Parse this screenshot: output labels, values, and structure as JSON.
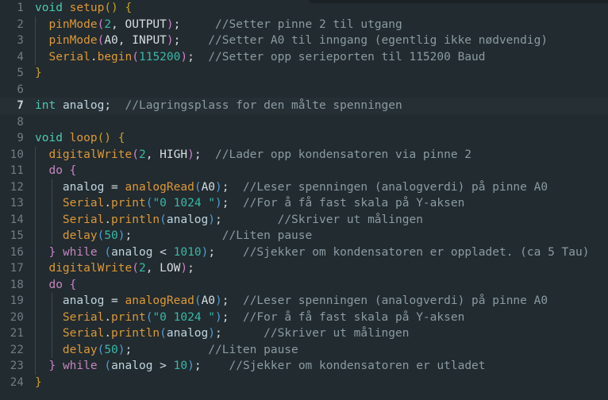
{
  "editor": {
    "language": "Arduino / C++",
    "theme": "dark",
    "active_line": 7,
    "total_lines": 24,
    "colors": {
      "background": "#222b2f",
      "active_line_background": "#262f34",
      "gutter_text": "#707f85",
      "default_text": "#d4dce0",
      "comment": "#8a9ba2",
      "type_keyword": "#4ec9b0",
      "function": "#dc9838",
      "control_keyword": "#c586c0",
      "number": "#39b8a8",
      "string": "#39b8a8",
      "variable": "#bfd4de",
      "bracket_level_1": "#c9a227",
      "bracket_level_2": "#cf7fcf",
      "bracket_level_3": "#4f9cd8",
      "indent_guide": "#3d4a50"
    },
    "line_numbers": [
      1,
      2,
      3,
      4,
      5,
      6,
      7,
      8,
      9,
      10,
      11,
      12,
      13,
      14,
      15,
      16,
      17,
      18,
      19,
      20,
      21,
      22,
      23,
      24
    ],
    "lines": [
      {
        "n": 1,
        "indent_guides": 0,
        "tokens": [
          {
            "c": "t-type",
            "t": "void"
          },
          {
            "c": "t-plain",
            "t": " "
          },
          {
            "c": "t-func",
            "t": "setup"
          },
          {
            "c": "t-paren1",
            "t": "()"
          },
          {
            "c": "t-plain",
            "t": " "
          },
          {
            "c": "t-brace",
            "t": "{"
          }
        ]
      },
      {
        "n": 2,
        "indent_guides": 1,
        "tokens": [
          {
            "c": "t-plain",
            "t": "  "
          },
          {
            "c": "t-func",
            "t": "pinMode"
          },
          {
            "c": "t-paren2",
            "t": "("
          },
          {
            "c": "t-num",
            "t": "2"
          },
          {
            "c": "t-punc",
            "t": ", "
          },
          {
            "c": "t-const",
            "t": "OUTPUT"
          },
          {
            "c": "t-paren2",
            "t": ")"
          },
          {
            "c": "t-punc",
            "t": ";"
          },
          {
            "c": "t-plain",
            "t": "     "
          },
          {
            "c": "t-comment",
            "t": "//Setter pinne 2 til utgang"
          }
        ]
      },
      {
        "n": 3,
        "indent_guides": 1,
        "tokens": [
          {
            "c": "t-plain",
            "t": "  "
          },
          {
            "c": "t-func",
            "t": "pinMode"
          },
          {
            "c": "t-paren2",
            "t": "("
          },
          {
            "c": "t-const",
            "t": "A0"
          },
          {
            "c": "t-punc",
            "t": ", "
          },
          {
            "c": "t-const",
            "t": "INPUT"
          },
          {
            "c": "t-paren2",
            "t": ")"
          },
          {
            "c": "t-punc",
            "t": ";"
          },
          {
            "c": "t-plain",
            "t": "    "
          },
          {
            "c": "t-comment",
            "t": "//Setter A0 til inngang (egentlig ikke nødvendig)"
          }
        ]
      },
      {
        "n": 4,
        "indent_guides": 1,
        "tokens": [
          {
            "c": "t-plain",
            "t": "  "
          },
          {
            "c": "t-func",
            "t": "Serial"
          },
          {
            "c": "t-punc",
            "t": "."
          },
          {
            "c": "t-func",
            "t": "begin"
          },
          {
            "c": "t-paren2",
            "t": "("
          },
          {
            "c": "t-num",
            "t": "115200"
          },
          {
            "c": "t-paren2",
            "t": ")"
          },
          {
            "c": "t-punc",
            "t": ";"
          },
          {
            "c": "t-plain",
            "t": "  "
          },
          {
            "c": "t-comment",
            "t": "//Setter opp serieporten til 115200 Baud"
          }
        ]
      },
      {
        "n": 5,
        "indent_guides": 0,
        "tokens": [
          {
            "c": "t-brace",
            "t": "}"
          }
        ]
      },
      {
        "n": 6,
        "indent_guides": 0,
        "tokens": []
      },
      {
        "n": 7,
        "indent_guides": 0,
        "tokens": [
          {
            "c": "t-type",
            "t": "int"
          },
          {
            "c": "t-plain",
            "t": " "
          },
          {
            "c": "t-var",
            "t": "analog"
          },
          {
            "c": "t-punc",
            "t": ";"
          },
          {
            "c": "t-plain",
            "t": "  "
          },
          {
            "c": "t-comment",
            "t": "//Lagringsplass for den målte spenningen"
          }
        ]
      },
      {
        "n": 8,
        "indent_guides": 0,
        "tokens": []
      },
      {
        "n": 9,
        "indent_guides": 0,
        "tokens": [
          {
            "c": "t-type",
            "t": "void"
          },
          {
            "c": "t-plain",
            "t": " "
          },
          {
            "c": "t-func",
            "t": "loop"
          },
          {
            "c": "t-paren1",
            "t": "()"
          },
          {
            "c": "t-plain",
            "t": " "
          },
          {
            "c": "t-brace",
            "t": "{"
          }
        ]
      },
      {
        "n": 10,
        "indent_guides": 1,
        "tokens": [
          {
            "c": "t-plain",
            "t": "  "
          },
          {
            "c": "t-func",
            "t": "digitalWrite"
          },
          {
            "c": "t-paren2",
            "t": "("
          },
          {
            "c": "t-num",
            "t": "2"
          },
          {
            "c": "t-punc",
            "t": ", "
          },
          {
            "c": "t-const",
            "t": "HIGH"
          },
          {
            "c": "t-paren2",
            "t": ")"
          },
          {
            "c": "t-punc",
            "t": ";"
          },
          {
            "c": "t-plain",
            "t": "  "
          },
          {
            "c": "t-comment",
            "t": "//Lader opp kondensatoren via pinne 2"
          }
        ]
      },
      {
        "n": 11,
        "indent_guides": 1,
        "tokens": [
          {
            "c": "t-plain",
            "t": "  "
          },
          {
            "c": "t-kw",
            "t": "do"
          },
          {
            "c": "t-plain",
            "t": " "
          },
          {
            "c": "t-paren2",
            "t": "{"
          }
        ]
      },
      {
        "n": 12,
        "indent_guides": 2,
        "tokens": [
          {
            "c": "t-plain",
            "t": "    "
          },
          {
            "c": "t-var",
            "t": "analog"
          },
          {
            "c": "t-op",
            "t": " = "
          },
          {
            "c": "t-func",
            "t": "analogRead"
          },
          {
            "c": "t-paren3",
            "t": "("
          },
          {
            "c": "t-const",
            "t": "A0"
          },
          {
            "c": "t-paren3",
            "t": ")"
          },
          {
            "c": "t-punc",
            "t": ";"
          },
          {
            "c": "t-plain",
            "t": "  "
          },
          {
            "c": "t-comment",
            "t": "//Leser spenningen (analogverdi) på pinne A0"
          }
        ]
      },
      {
        "n": 13,
        "indent_guides": 2,
        "tokens": [
          {
            "c": "t-plain",
            "t": "    "
          },
          {
            "c": "t-func",
            "t": "Serial"
          },
          {
            "c": "t-punc",
            "t": "."
          },
          {
            "c": "t-func",
            "t": "print"
          },
          {
            "c": "t-paren3",
            "t": "("
          },
          {
            "c": "t-str",
            "t": "\"0 1024 \""
          },
          {
            "c": "t-paren3",
            "t": ")"
          },
          {
            "c": "t-punc",
            "t": ";"
          },
          {
            "c": "t-plain",
            "t": "  "
          },
          {
            "c": "t-comment",
            "t": "//For å få fast skala på Y-aksen"
          }
        ]
      },
      {
        "n": 14,
        "indent_guides": 2,
        "tokens": [
          {
            "c": "t-plain",
            "t": "    "
          },
          {
            "c": "t-func",
            "t": "Serial"
          },
          {
            "c": "t-punc",
            "t": "."
          },
          {
            "c": "t-func",
            "t": "println"
          },
          {
            "c": "t-paren3",
            "t": "("
          },
          {
            "c": "t-var",
            "t": "analog"
          },
          {
            "c": "t-paren3",
            "t": ")"
          },
          {
            "c": "t-punc",
            "t": ";"
          },
          {
            "c": "t-plain",
            "t": "        "
          },
          {
            "c": "t-comment",
            "t": "//Skriver ut målingen"
          }
        ]
      },
      {
        "n": 15,
        "indent_guides": 2,
        "tokens": [
          {
            "c": "t-plain",
            "t": "    "
          },
          {
            "c": "t-func",
            "t": "delay"
          },
          {
            "c": "t-paren3",
            "t": "("
          },
          {
            "c": "t-num",
            "t": "50"
          },
          {
            "c": "t-paren3",
            "t": ")"
          },
          {
            "c": "t-punc",
            "t": ";"
          },
          {
            "c": "t-plain",
            "t": "             "
          },
          {
            "c": "t-comment",
            "t": "//Liten pause"
          }
        ]
      },
      {
        "n": 16,
        "indent_guides": 1,
        "tokens": [
          {
            "c": "t-plain",
            "t": "  "
          },
          {
            "c": "t-paren2",
            "t": "}"
          },
          {
            "c": "t-plain",
            "t": " "
          },
          {
            "c": "t-kw",
            "t": "while"
          },
          {
            "c": "t-plain",
            "t": " "
          },
          {
            "c": "t-paren3",
            "t": "("
          },
          {
            "c": "t-var",
            "t": "analog"
          },
          {
            "c": "t-op",
            "t": " < "
          },
          {
            "c": "t-num",
            "t": "1010"
          },
          {
            "c": "t-paren3",
            "t": ")"
          },
          {
            "c": "t-punc",
            "t": ";"
          },
          {
            "c": "t-plain",
            "t": "    "
          },
          {
            "c": "t-comment",
            "t": "//Sjekker om kondensatoren er oppladet. (ca 5 Tau)"
          }
        ]
      },
      {
        "n": 17,
        "indent_guides": 1,
        "tokens": [
          {
            "c": "t-plain",
            "t": "  "
          },
          {
            "c": "t-func",
            "t": "digitalWrite"
          },
          {
            "c": "t-paren2",
            "t": "("
          },
          {
            "c": "t-num",
            "t": "2"
          },
          {
            "c": "t-punc",
            "t": ", "
          },
          {
            "c": "t-const",
            "t": "LOW"
          },
          {
            "c": "t-paren2",
            "t": ")"
          },
          {
            "c": "t-punc",
            "t": ";"
          }
        ]
      },
      {
        "n": 18,
        "indent_guides": 1,
        "tokens": [
          {
            "c": "t-plain",
            "t": "  "
          },
          {
            "c": "t-kw",
            "t": "do"
          },
          {
            "c": "t-plain",
            "t": " "
          },
          {
            "c": "t-paren2",
            "t": "{"
          }
        ]
      },
      {
        "n": 19,
        "indent_guides": 2,
        "tokens": [
          {
            "c": "t-plain",
            "t": "    "
          },
          {
            "c": "t-var",
            "t": "analog"
          },
          {
            "c": "t-op",
            "t": " = "
          },
          {
            "c": "t-func",
            "t": "analogRead"
          },
          {
            "c": "t-paren3",
            "t": "("
          },
          {
            "c": "t-const",
            "t": "A0"
          },
          {
            "c": "t-paren3",
            "t": ")"
          },
          {
            "c": "t-punc",
            "t": ";"
          },
          {
            "c": "t-plain",
            "t": "  "
          },
          {
            "c": "t-comment",
            "t": "//Leser spenningen (analogverdi) på pinne A0"
          }
        ]
      },
      {
        "n": 20,
        "indent_guides": 2,
        "tokens": [
          {
            "c": "t-plain",
            "t": "    "
          },
          {
            "c": "t-func",
            "t": "Serial"
          },
          {
            "c": "t-punc",
            "t": "."
          },
          {
            "c": "t-func",
            "t": "print"
          },
          {
            "c": "t-paren3",
            "t": "("
          },
          {
            "c": "t-str",
            "t": "\"0 1024 \""
          },
          {
            "c": "t-paren3",
            "t": ")"
          },
          {
            "c": "t-punc",
            "t": ";"
          },
          {
            "c": "t-plain",
            "t": "  "
          },
          {
            "c": "t-comment",
            "t": "//For å få fast skala på Y-aksen"
          }
        ]
      },
      {
        "n": 21,
        "indent_guides": 2,
        "tokens": [
          {
            "c": "t-plain",
            "t": "    "
          },
          {
            "c": "t-func",
            "t": "Serial"
          },
          {
            "c": "t-punc",
            "t": "."
          },
          {
            "c": "t-func",
            "t": "println"
          },
          {
            "c": "t-paren3",
            "t": "("
          },
          {
            "c": "t-var",
            "t": "analog"
          },
          {
            "c": "t-paren3",
            "t": ")"
          },
          {
            "c": "t-punc",
            "t": ";"
          },
          {
            "c": "t-plain",
            "t": "      "
          },
          {
            "c": "t-comment",
            "t": "//Skriver ut målingen"
          }
        ]
      },
      {
        "n": 22,
        "indent_guides": 2,
        "tokens": [
          {
            "c": "t-plain",
            "t": "    "
          },
          {
            "c": "t-func",
            "t": "delay"
          },
          {
            "c": "t-paren3",
            "t": "("
          },
          {
            "c": "t-num",
            "t": "50"
          },
          {
            "c": "t-paren3",
            "t": ")"
          },
          {
            "c": "t-punc",
            "t": ";"
          },
          {
            "c": "t-plain",
            "t": "           "
          },
          {
            "c": "t-comment",
            "t": "//Liten pause"
          }
        ]
      },
      {
        "n": 23,
        "indent_guides": 1,
        "tokens": [
          {
            "c": "t-plain",
            "t": "  "
          },
          {
            "c": "t-paren2",
            "t": "}"
          },
          {
            "c": "t-plain",
            "t": " "
          },
          {
            "c": "t-kw",
            "t": "while"
          },
          {
            "c": "t-plain",
            "t": " "
          },
          {
            "c": "t-paren3",
            "t": "("
          },
          {
            "c": "t-var",
            "t": "analog"
          },
          {
            "c": "t-op",
            "t": " > "
          },
          {
            "c": "t-num",
            "t": "10"
          },
          {
            "c": "t-paren3",
            "t": ")"
          },
          {
            "c": "t-punc",
            "t": ";"
          },
          {
            "c": "t-plain",
            "t": "    "
          },
          {
            "c": "t-comment",
            "t": "//Sjekker om kondensatoren er utladet"
          }
        ]
      },
      {
        "n": 24,
        "indent_guides": 0,
        "tokens": [
          {
            "c": "t-brace",
            "t": "}"
          }
        ]
      }
    ]
  }
}
